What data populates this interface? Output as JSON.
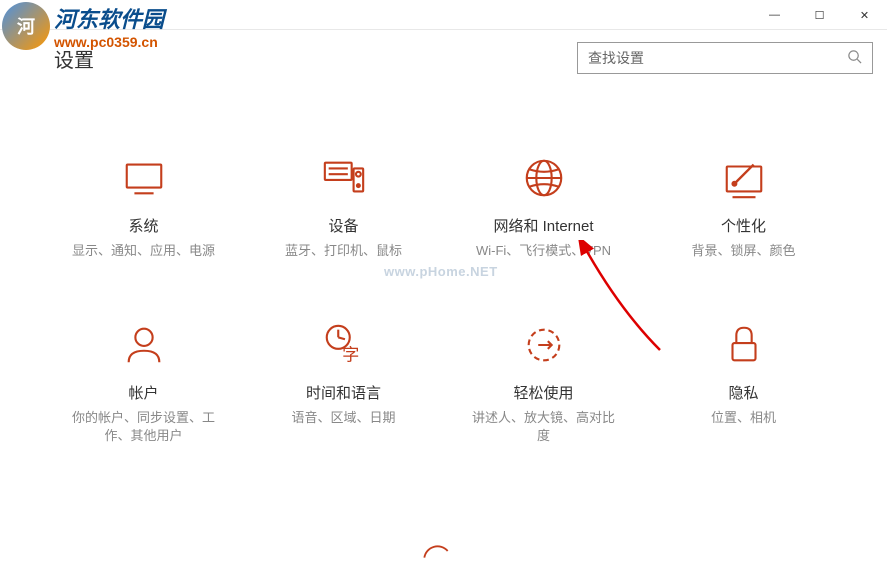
{
  "window": {
    "title": "设置",
    "minimize": "—",
    "maximize": "☐",
    "close": "✕"
  },
  "watermark": {
    "cn": "河东软件园",
    "url": "www.pc0359.cn",
    "center": "www.pHome.NET"
  },
  "header": {
    "title": "设置",
    "search_placeholder": "查找设置"
  },
  "tiles": [
    {
      "id": "system",
      "title": "系统",
      "desc": "显示、通知、应用、电源"
    },
    {
      "id": "devices",
      "title": "设备",
      "desc": "蓝牙、打印机、鼠标"
    },
    {
      "id": "network",
      "title": "网络和 Internet",
      "desc": "Wi-Fi、飞行模式、VPN"
    },
    {
      "id": "personalization",
      "title": "个性化",
      "desc": "背景、锁屏、颜色"
    },
    {
      "id": "accounts",
      "title": "帐户",
      "desc": "你的帐户、同步设置、工作、其他用户"
    },
    {
      "id": "time",
      "title": "时间和语言",
      "desc": "语音、区域、日期"
    },
    {
      "id": "ease",
      "title": "轻松使用",
      "desc": "讲述人、放大镜、高对比度"
    },
    {
      "id": "privacy",
      "title": "隐私",
      "desc": "位置、相机"
    }
  ],
  "accent": "#c43e1c"
}
